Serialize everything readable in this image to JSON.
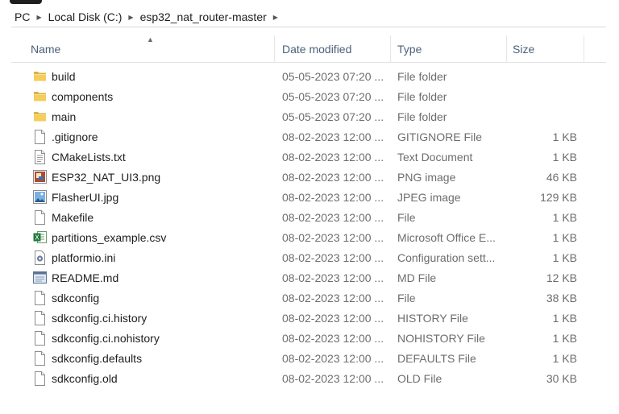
{
  "breadcrumb": [
    "PC",
    "Local Disk (C:)",
    "esp32_nat_router-master"
  ],
  "columns": {
    "name": "Name",
    "date": "Date modified",
    "type": "Type",
    "size": "Size"
  },
  "files": [
    {
      "name": "build",
      "date": "05-05-2023 07:20 ...",
      "type": "File folder",
      "size": "",
      "icon": "folder-icon"
    },
    {
      "name": "components",
      "date": "05-05-2023 07:20 ...",
      "type": "File folder",
      "size": "",
      "icon": "folder-icon"
    },
    {
      "name": "main",
      "date": "05-05-2023 07:20 ...",
      "type": "File folder",
      "size": "",
      "icon": "folder-icon"
    },
    {
      "name": ".gitignore",
      "date": "08-02-2023 12:00 ...",
      "type": "GITIGNORE File",
      "size": "1 KB",
      "icon": "file-icon"
    },
    {
      "name": "CMakeLists.txt",
      "date": "08-02-2023 12:00 ...",
      "type": "Text Document",
      "size": "1 KB",
      "icon": "text-file-icon"
    },
    {
      "name": "ESP32_NAT_UI3.png",
      "date": "08-02-2023 12:00 ...",
      "type": "PNG image",
      "size": "46 KB",
      "icon": "png-image-icon"
    },
    {
      "name": "FlasherUI.jpg",
      "date": "08-02-2023 12:00 ...",
      "type": "JPEG image",
      "size": "129 KB",
      "icon": "jpeg-image-icon"
    },
    {
      "name": "Makefile",
      "date": "08-02-2023 12:00 ...",
      "type": "File",
      "size": "1 KB",
      "icon": "file-icon"
    },
    {
      "name": "partitions_example.csv",
      "date": "08-02-2023 12:00 ...",
      "type": "Microsoft Office E...",
      "size": "1 KB",
      "icon": "excel-csv-icon"
    },
    {
      "name": "platformio.ini",
      "date": "08-02-2023 12:00 ...",
      "type": "Configuration sett...",
      "size": "1 KB",
      "icon": "settings-file-icon"
    },
    {
      "name": "README.md",
      "date": "08-02-2023 12:00 ...",
      "type": "MD File",
      "size": "12 KB",
      "icon": "md-file-icon"
    },
    {
      "name": "sdkconfig",
      "date": "08-02-2023 12:00 ...",
      "type": "File",
      "size": "38 KB",
      "icon": "file-icon"
    },
    {
      "name": "sdkconfig.ci.history",
      "date": "08-02-2023 12:00 ...",
      "type": "HISTORY File",
      "size": "1 KB",
      "icon": "file-icon"
    },
    {
      "name": "sdkconfig.ci.nohistory",
      "date": "08-02-2023 12:00 ...",
      "type": "NOHISTORY File",
      "size": "1 KB",
      "icon": "file-icon"
    },
    {
      "name": "sdkconfig.defaults",
      "date": "08-02-2023 12:00 ...",
      "type": "DEFAULTS File",
      "size": "1 KB",
      "icon": "file-icon"
    },
    {
      "name": "sdkconfig.old",
      "date": "08-02-2023 12:00 ...",
      "type": "OLD File",
      "size": "30 KB",
      "icon": "file-icon"
    }
  ]
}
